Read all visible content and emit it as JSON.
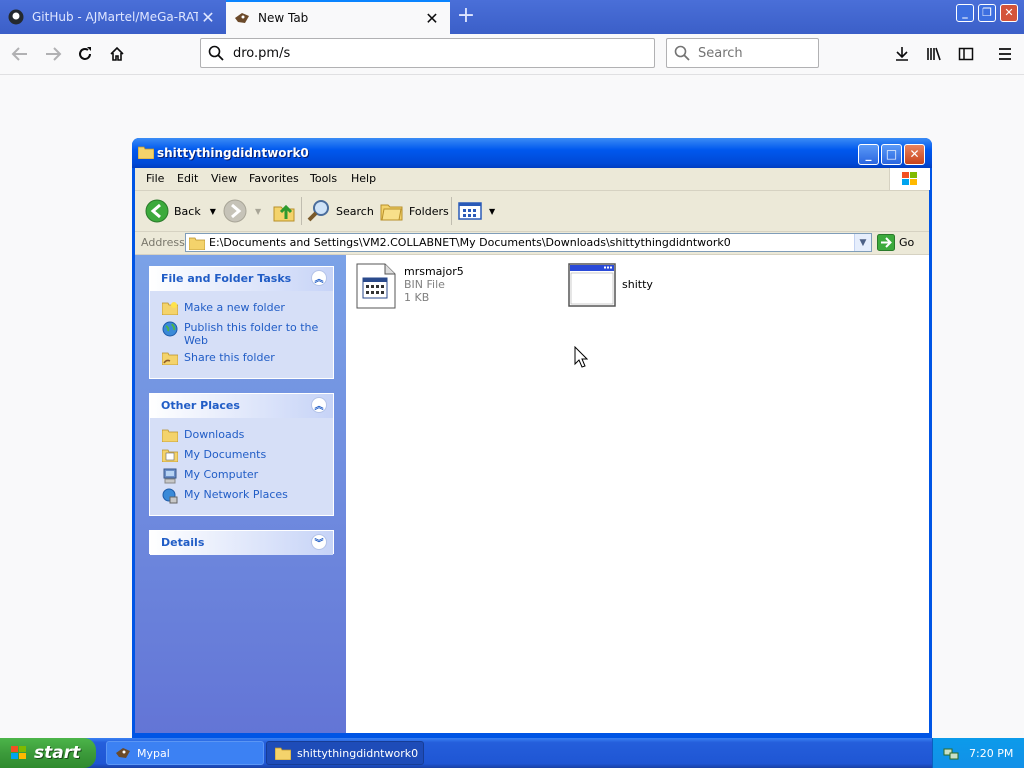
{
  "browser": {
    "tabs": [
      {
        "label": "GitHub - AJMartel/MeGa-RAT-Pac",
        "active": false
      },
      {
        "label": "New Tab",
        "active": true
      }
    ],
    "url": "dro.pm/s",
    "search_placeholder": "Search"
  },
  "explorer": {
    "title": "shittythingdidntwork0",
    "menu": [
      "File",
      "Edit",
      "View",
      "Favorites",
      "Tools",
      "Help"
    ],
    "toolbar": {
      "back": "Back",
      "search": "Search",
      "folders": "Folders"
    },
    "address": {
      "label": "Address",
      "path": "E:\\Documents and Settings\\VM2.COLLABNET\\My Documents\\Downloads\\shittythingdidntwork0",
      "go": "Go"
    },
    "panels": {
      "tasks": {
        "title": "File and Folder Tasks",
        "items": [
          "Make a new folder",
          "Publish this folder to the Web",
          "Share this folder"
        ]
      },
      "places": {
        "title": "Other Places",
        "items": [
          "Downloads",
          "My Documents",
          "My Computer",
          "My Network Places"
        ]
      },
      "details": {
        "title": "Details"
      }
    },
    "files": [
      {
        "name": "mrsmajor5",
        "type": "BIN File",
        "size": "1 KB"
      },
      {
        "name": "shitty"
      }
    ]
  },
  "taskbar": {
    "start": "start",
    "items": [
      "Mypal",
      "shittythingdidntwork0"
    ],
    "clock": "7:20 PM"
  },
  "colors": {
    "xp_blue": "#0055e5",
    "task_link": "#215dc6",
    "start_green": "#3c9b3b"
  }
}
